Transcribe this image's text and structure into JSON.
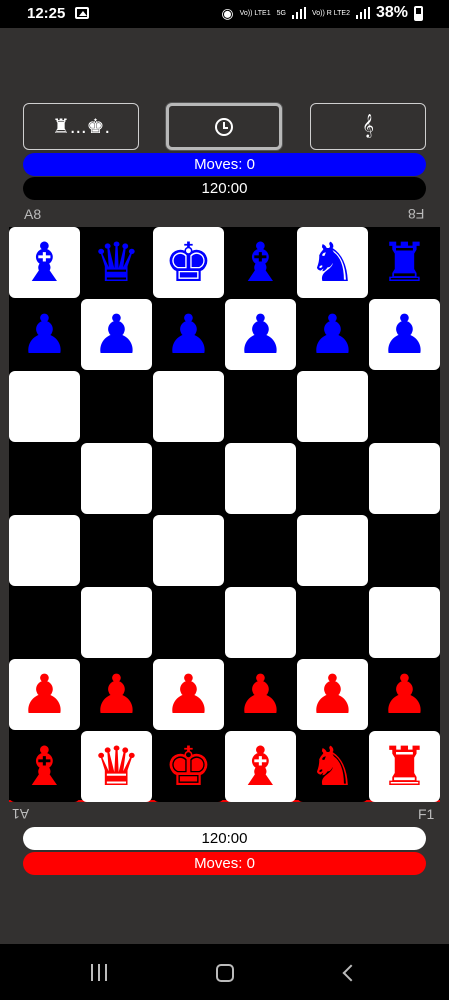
{
  "status": {
    "time": "12:25",
    "volte1": "Vo)) LTE1",
    "net": "5G",
    "volte2": "Vo)) R LTE2",
    "battery": "38%"
  },
  "toolbar": {
    "pieces_label": "♜...♚.",
    "timer_icon": "clock-icon",
    "sound_label": "𝄞"
  },
  "top_player": {
    "moves": "Moves: 0",
    "clock": "120:00",
    "color": "#0000ff"
  },
  "bottom_player": {
    "clock": "120:00",
    "moves": "Moves: 0",
    "color": "#ff0000"
  },
  "corners": {
    "top_left": "A8",
    "top_right": "F8",
    "bottom_left": "A1",
    "bottom_right": "F1"
  },
  "board": {
    "rows": [
      [
        {
          "p": "♝",
          "c": "blue"
        },
        {
          "p": "♛",
          "c": "blue"
        },
        {
          "p": "♚",
          "c": "blue"
        },
        {
          "p": "♝",
          "c": "blue"
        },
        {
          "p": "♞",
          "c": "blue"
        },
        {
          "p": "♜",
          "c": "blue"
        }
      ],
      [
        {
          "p": "♟",
          "c": "blue"
        },
        {
          "p": "♟",
          "c": "blue"
        },
        {
          "p": "♟",
          "c": "blue"
        },
        {
          "p": "♟",
          "c": "blue"
        },
        {
          "p": "♟",
          "c": "blue"
        },
        {
          "p": "♟",
          "c": "blue"
        }
      ],
      [
        {
          "p": "",
          "c": ""
        },
        {
          "p": "",
          "c": ""
        },
        {
          "p": "",
          "c": ""
        },
        {
          "p": "",
          "c": ""
        },
        {
          "p": "",
          "c": ""
        },
        {
          "p": "",
          "c": ""
        }
      ],
      [
        {
          "p": "",
          "c": ""
        },
        {
          "p": "",
          "c": ""
        },
        {
          "p": "",
          "c": ""
        },
        {
          "p": "",
          "c": ""
        },
        {
          "p": "",
          "c": ""
        },
        {
          "p": "",
          "c": ""
        }
      ],
      [
        {
          "p": "",
          "c": ""
        },
        {
          "p": "",
          "c": ""
        },
        {
          "p": "",
          "c": ""
        },
        {
          "p": "",
          "c": ""
        },
        {
          "p": "",
          "c": ""
        },
        {
          "p": "",
          "c": ""
        }
      ],
      [
        {
          "p": "",
          "c": ""
        },
        {
          "p": "",
          "c": ""
        },
        {
          "p": "",
          "c": ""
        },
        {
          "p": "",
          "c": ""
        },
        {
          "p": "",
          "c": ""
        },
        {
          "p": "",
          "c": ""
        }
      ],
      [
        {
          "p": "♟",
          "c": "red"
        },
        {
          "p": "♟",
          "c": "red"
        },
        {
          "p": "♟",
          "c": "red"
        },
        {
          "p": "♟",
          "c": "red"
        },
        {
          "p": "♟",
          "c": "red"
        },
        {
          "p": "♟",
          "c": "red"
        }
      ],
      [
        {
          "p": "♝",
          "c": "red"
        },
        {
          "p": "♛",
          "c": "red"
        },
        {
          "p": "♚",
          "c": "red"
        },
        {
          "p": "♝",
          "c": "red"
        },
        {
          "p": "♞",
          "c": "red"
        },
        {
          "p": "♜",
          "c": "red"
        }
      ]
    ]
  }
}
